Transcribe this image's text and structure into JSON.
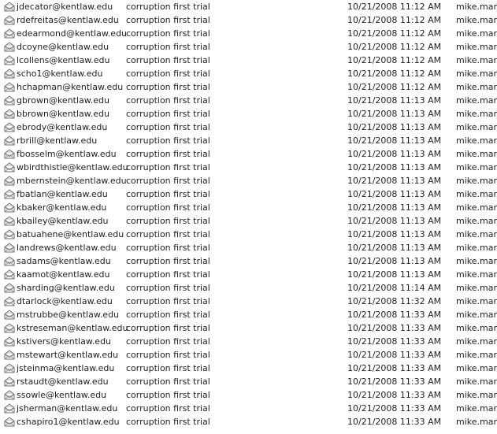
{
  "envelope_icon": "open-envelope-icon",
  "rows": [
    {
      "email": "jdecator@kentlaw.edu",
      "subject": "corruption first trial",
      "date": "10/21/2008 11:12 AM",
      "owner": "mike.mars"
    },
    {
      "email": "rdefreitas@kentlaw.edu",
      "subject": "corruption first trial",
      "date": "10/21/2008 11:12 AM",
      "owner": "mike.mars"
    },
    {
      "email": "edearmond@kentlaw.edu",
      "subject": "corruption first trial",
      "date": "10/21/2008 11:12 AM",
      "owner": "mike.mars"
    },
    {
      "email": "dcoyne@kentlaw.edu",
      "subject": "corruption first trial",
      "date": "10/21/2008 11:12 AM",
      "owner": "mike.mars"
    },
    {
      "email": "lcollens@kentlaw.edu",
      "subject": "corruption first trial",
      "date": "10/21/2008 11:12 AM",
      "owner": "mike.mars"
    },
    {
      "email": "scho1@kentlaw.edu",
      "subject": "corruption first trial",
      "date": "10/21/2008 11:12 AM",
      "owner": "mike.mars"
    },
    {
      "email": "hchapman@kentlaw.edu",
      "subject": "corruption first trial",
      "date": "10/21/2008 11:12 AM",
      "owner": "mike.mars"
    },
    {
      "email": "gbrown@kentlaw.edu",
      "subject": "corruption first trial",
      "date": "10/21/2008 11:13 AM",
      "owner": "mike.mars"
    },
    {
      "email": "bbrown@kentlaw.edu",
      "subject": "corruption first trial",
      "date": "10/21/2008 11:13 AM",
      "owner": "mike.mars"
    },
    {
      "email": "ebrody@kentlaw.edu",
      "subject": "corruption first trial",
      "date": "10/21/2008 11:13 AM",
      "owner": "mike.mars"
    },
    {
      "email": "rbrill@kentlaw.edu",
      "subject": "corruption first trial",
      "date": "10/21/2008 11:13 AM",
      "owner": "mike.mars"
    },
    {
      "email": "fbosselm@kentlaw.edu",
      "subject": "corruption first trial",
      "date": "10/21/2008 11:13 AM",
      "owner": "mike.mars"
    },
    {
      "email": "wbirdthistle@kentlaw.edu",
      "subject": "corruption first trial",
      "date": "10/21/2008 11:13 AM",
      "owner": "mike.mars"
    },
    {
      "email": "mbernstein@kentlaw.edu",
      "subject": "corruption first trial",
      "date": "10/21/2008 11:13 AM",
      "owner": "mike.mars"
    },
    {
      "email": "fbatlan@kentlaw.edu",
      "subject": "corruption first trial",
      "date": "10/21/2008 11:13 AM",
      "owner": "mike.mars"
    },
    {
      "email": "kbaker@kentlaw.edu",
      "subject": "corruption first trial",
      "date": "10/21/2008 11:13 AM",
      "owner": "mike.mars"
    },
    {
      "email": "kbailey@kentlaw.edu",
      "subject": "corruption first trial",
      "date": "10/21/2008 11:13 AM",
      "owner": "mike.mars"
    },
    {
      "email": "batuahene@kentlaw.edu",
      "subject": "corruption first trial",
      "date": "10/21/2008 11:13 AM",
      "owner": "mike.mars"
    },
    {
      "email": "landrews@kentlaw.edu",
      "subject": "corruption first trial",
      "date": "10/21/2008 11:13 AM",
      "owner": "mike.mars"
    },
    {
      "email": "sadams@kentlaw.edu",
      "subject": "corruption first trial",
      "date": "10/21/2008 11:13 AM",
      "owner": "mike.mars"
    },
    {
      "email": "kaamot@kentlaw.edu",
      "subject": "corruption first trial",
      "date": "10/21/2008 11:13 AM",
      "owner": "mike.mars"
    },
    {
      "email": "sharding@kentlaw.edu",
      "subject": "corruption first trial",
      "date": "10/21/2008 11:14 AM",
      "owner": "mike.mars"
    },
    {
      "email": "dtarlock@kentlaw.edu",
      "subject": "corruption first trial",
      "date": "10/21/2008 11:32 AM",
      "owner": "mike.mars"
    },
    {
      "email": "mstrubbe@kentlaw.edu",
      "subject": "corruption first trial",
      "date": "10/21/2008 11:33 AM",
      "owner": "mike.mars"
    },
    {
      "email": "kstreseman@kentlaw.edu",
      "subject": "corruption first trial",
      "date": "10/21/2008 11:33 AM",
      "owner": "mike.mars"
    },
    {
      "email": "kstivers@kentlaw.edu",
      "subject": "corruption first trial",
      "date": "10/21/2008 11:33 AM",
      "owner": "mike.mars"
    },
    {
      "email": "mstewart@kentlaw.edu",
      "subject": "corruption first trial",
      "date": "10/21/2008 11:33 AM",
      "owner": "mike.mars"
    },
    {
      "email": "jsteinma@kentlaw.edu",
      "subject": "corruption first trial",
      "date": "10/21/2008 11:33 AM",
      "owner": "mike.mars"
    },
    {
      "email": "rstaudt@kentlaw.edu",
      "subject": "corruption first trial",
      "date": "10/21/2008 11:33 AM",
      "owner": "mike.mars"
    },
    {
      "email": "ssowle@kentlaw.edu",
      "subject": "corruption first trial",
      "date": "10/21/2008 11:33 AM",
      "owner": "mike.mars"
    },
    {
      "email": "jsherman@kentlaw.edu",
      "subject": "corruption first trial",
      "date": "10/21/2008 11:33 AM",
      "owner": "mike.mars"
    },
    {
      "email": "cshapiro1@kentlaw.edu",
      "subject": "corruption first trial",
      "date": "10/21/2008 11:33 AM",
      "owner": "mike.mars"
    }
  ]
}
